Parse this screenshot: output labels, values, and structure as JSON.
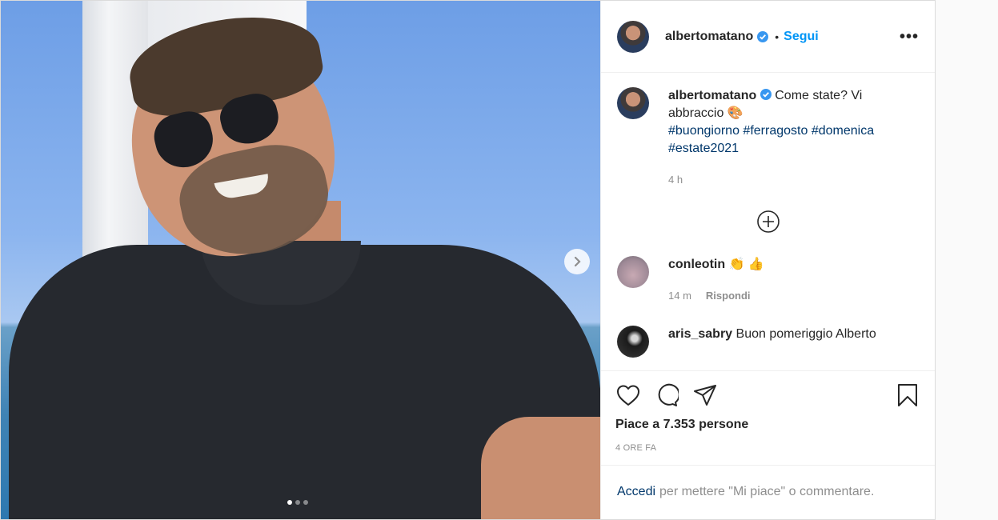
{
  "post": {
    "author": "albertomatano",
    "follow_label": "Segui",
    "separator": "•",
    "more_label": "•••"
  },
  "caption": {
    "author": "albertomatano",
    "text": "Come state? Vi abbraccio 🎨",
    "hashtags": [
      "#buongiorno",
      "#ferragosto",
      "#domenica",
      "#estate2021"
    ],
    "age": "4 h"
  },
  "comments": [
    {
      "author": "conleotin",
      "text": "👏 👍",
      "age": "14 m",
      "reply_label": "Rispondi"
    },
    {
      "author": "aris_sabry",
      "text": "Buon pomeriggio Alberto"
    }
  ],
  "likes": {
    "text": "Piace a 7.353 persone"
  },
  "timestamp": "4 ORE FA",
  "login_prompt": {
    "link": "Accedi",
    "text": "per mettere \"Mi piace\" o commentare."
  },
  "carousel": {
    "total": 3,
    "current": 1
  },
  "colors": {
    "link_blue": "#0095f6",
    "hashtag": "#00376b",
    "muted": "#8e8e8e",
    "verified": "#3897f0"
  },
  "icons": [
    "chevron-right-icon",
    "verified-icon",
    "more-icon",
    "add-circle-icon",
    "heart-icon",
    "comment-icon",
    "share-icon",
    "bookmark-icon"
  ]
}
